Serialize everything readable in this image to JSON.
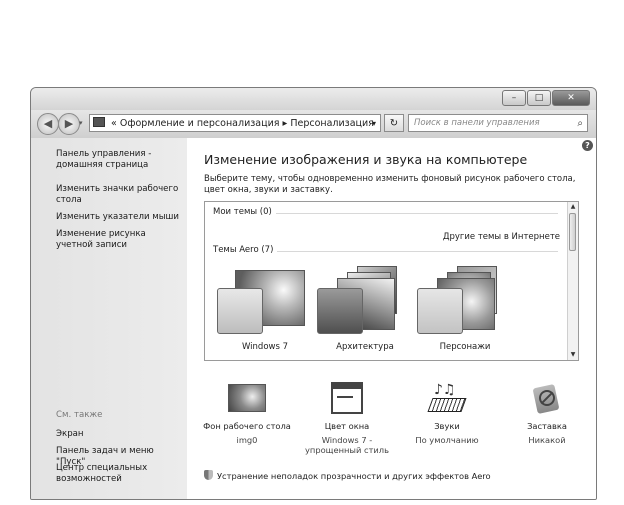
{
  "window": {
    "controls": {
      "minimize": "–",
      "maximize": "□",
      "close": "✕"
    }
  },
  "nav": {
    "back": "◀",
    "forward": "▶",
    "breadcrumb_prefix": "«",
    "crumb1": "Оформление и персонализация",
    "separator": "▸",
    "crumb2": "Персонализация",
    "dropdown": "▾",
    "refresh": "↻",
    "search_placeholder": "Поиск в панели управления",
    "search_icon": "⌕"
  },
  "sidebar": {
    "links": [
      "Панель управления - домашняя страница",
      "Изменить значки рабочего стола",
      "Изменить указатели мыши",
      "Изменение рисунка учетной записи"
    ],
    "see_also_heading": "См. также",
    "see_also": [
      "Экран",
      "Панель задач и меню \"Пуск\"",
      "Центр специальных возможностей"
    ]
  },
  "main": {
    "help": "?",
    "heading": "Изменение изображения и звука на компьютере",
    "description": "Выберите тему, чтобы одновременно изменить фоновый рисунок рабочего стола, цвет окна, звуки и заставку.",
    "my_themes": "Мои темы (0)",
    "online_link": "Другие темы в Интернете",
    "aero_themes": "Темы Aero (7)",
    "themes": [
      {
        "name": "Windows 7"
      },
      {
        "name": "Архитектура"
      },
      {
        "name": "Персонажи"
      }
    ],
    "settings": [
      {
        "label": "Фон рабочего стола",
        "value": "img0"
      },
      {
        "label": "Цвет окна",
        "value": "Windows 7 - упрощенный стиль"
      },
      {
        "label": "Звуки",
        "value": "По умолчанию"
      },
      {
        "label": "Заставка",
        "value": "Никакой"
      }
    ],
    "troubleshoot": "Устранение неполадок прозрачности и других эффектов Aero"
  }
}
